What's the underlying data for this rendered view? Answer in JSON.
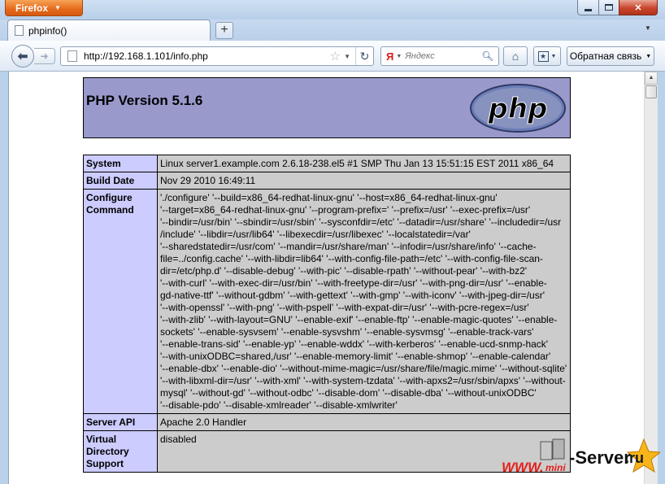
{
  "window": {
    "app_button": "Firefox",
    "controls": {
      "minimize": "minimize",
      "maximize": "maximize",
      "close": "✕"
    }
  },
  "tabs": [
    {
      "label": "phpinfo()"
    }
  ],
  "toolbar": {
    "url": "http://192.168.1.101/info.php",
    "search_placeholder": "Яндекс",
    "search_engine_glyph": "Я",
    "feedback_label": "Обратная связь"
  },
  "page": {
    "php_title": "PHP Version 5.1.6",
    "logo_text": "php",
    "rows": [
      {
        "key": "System",
        "value": "Linux server1.example.com 2.6.18-238.el5 #1 SMP Thu Jan 13 15:51:15 EST 2011 x86_64"
      },
      {
        "key": "Build Date",
        "value": "Nov 29 2010 16:49:11"
      },
      {
        "key": "Configure Command",
        "lines": [
          "'./configure' '--build=x86_64-redhat-linux-gnu' '--host=x86_64-redhat-linux-gnu'",
          "'--target=x86_64-redhat-linux-gnu' '--program-prefix=' '--prefix=/usr' '--exec-prefix=/usr'",
          "'--bindir=/usr/bin' '--sbindir=/usr/sbin' '--sysconfdir=/etc' '--datadir=/usr/share' '--includedir=/usr",
          "/include' '--libdir=/usr/lib64' '--libexecdir=/usr/libexec' '--localstatedir=/var'",
          "'--sharedstatedir=/usr/com' '--mandir=/usr/share/man' '--infodir=/usr/share/info' '--cache-",
          "file=../config.cache' '--with-libdir=lib64' '--with-config-file-path=/etc' '--with-config-file-scan-",
          "dir=/etc/php.d' '--disable-debug' '--with-pic' '--disable-rpath' '--without-pear' '--with-bz2'",
          "'--with-curl' '--with-exec-dir=/usr/bin' '--with-freetype-dir=/usr' '--with-png-dir=/usr' '--enable-",
          "gd-native-ttf' '--without-gdbm' '--with-gettext' '--with-gmp' '--with-iconv' '--with-jpeg-dir=/usr'",
          "'--with-openssl' '--with-png' '--with-pspell' '--with-expat-dir=/usr' '--with-pcre-regex=/usr'",
          "'--with-zlib' '--with-layout=GNU' '--enable-exif' '--enable-ftp' '--enable-magic-quotes' '--enable-",
          "sockets' '--enable-sysvsem' '--enable-sysvshm' '--enable-sysvmsg' '--enable-track-vars'",
          "'--enable-trans-sid' '--enable-yp' '--enable-wddx' '--with-kerberos' '--enable-ucd-snmp-hack'",
          "'--with-unixODBC=shared,/usr' '--enable-memory-limit' '--enable-shmop' '--enable-calendar'",
          "'--enable-dbx' '--enable-dio' '--without-mime-magic=/usr/share/file/magic.mime' '--without-sqlite'",
          "'--with-libxml-dir=/usr' '--with-xml' '--with-system-tzdata' '--with-apxs2=/usr/sbin/apxs' '--without-",
          "mysql' '--without-gd' '--without-odbc' '--disable-dom' '--disable-dba' '--without-unixODBC'",
          "'--disable-pdo' '--disable-xmlreader' '--disable-xmlwriter'"
        ]
      },
      {
        "key": "Server API",
        "value": "Apache 2.0 Handler"
      },
      {
        "key": "Virtual Directory Support",
        "value": "disabled"
      }
    ]
  },
  "watermark": {
    "www": "WWW.",
    "mini": "mini",
    "server": "-Server",
    "tld": ".ru"
  },
  "colors": {
    "php_header_bg": "#9999cc",
    "key_cell_bg": "#ccccff",
    "value_cell_bg": "#cccccc",
    "firefox_orange": "#e5691a"
  }
}
